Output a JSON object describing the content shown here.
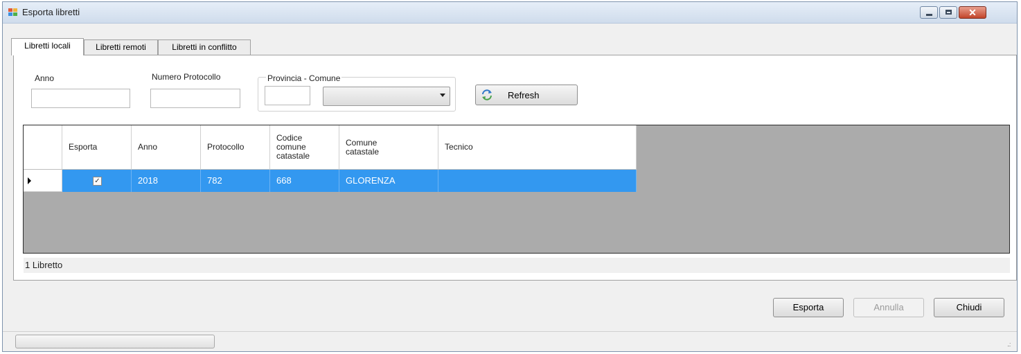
{
  "window": {
    "title": "Esporta libretti",
    "close_glyph": "✕"
  },
  "tabs": [
    {
      "label": "Libretti locali",
      "active": true
    },
    {
      "label": "Libretti remoti",
      "active": false
    },
    {
      "label": "Libretti in conflitto",
      "active": false
    }
  ],
  "filters": {
    "anno_label": "Anno",
    "anno_value": "",
    "protocollo_label": "Numero Protocollo",
    "protocollo_value": "",
    "group_label": "Provincia - Comune",
    "provincia_value": "",
    "comune_selected": "",
    "refresh_label": "Refresh",
    "refresh_icon": "refresh-icon"
  },
  "grid": {
    "columns": [
      "Esporta",
      "Anno",
      "Protocollo",
      "Codice comune catastale",
      "Comune catastale",
      "Tecnico"
    ],
    "rows": [
      {
        "esporta": true,
        "anno": "2018",
        "protocollo": "782",
        "codice": "668",
        "comune": "GLORENZA",
        "tecnico": ""
      }
    ],
    "checkbox_glyph": "✓"
  },
  "count_text": "1 Libretto",
  "buttons": {
    "esporta": "Esporta",
    "annulla": "Annulla",
    "chiudi": "Chiudi"
  },
  "status": {
    "progress": 0,
    "grip_glyph": "..:"
  },
  "colors": {
    "selection": "#3398f0",
    "grid_background": "#ababab",
    "title_gradient": "#cfdcec"
  }
}
